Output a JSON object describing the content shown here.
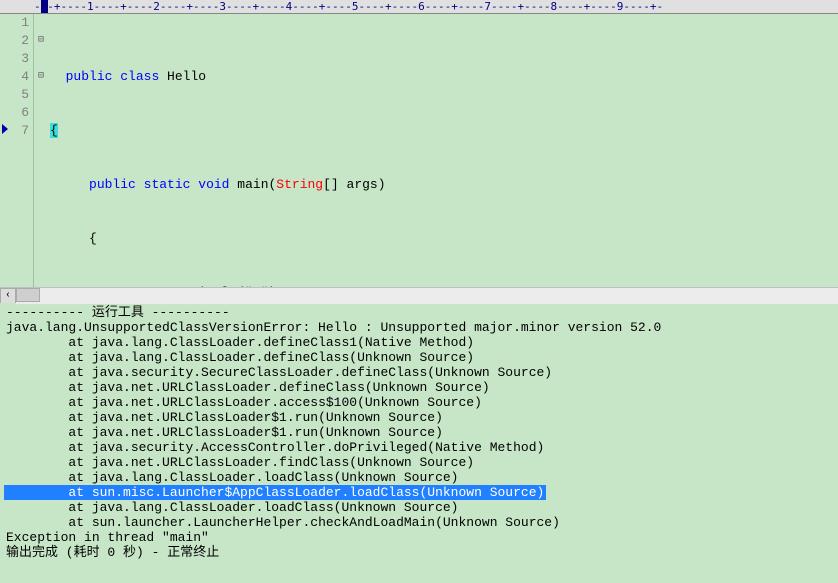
{
  "ruler": {
    "text": "---+----1----+----2----+----3----+----4----+----5----+----6----+----7----+----8----+----9----+-"
  },
  "editor": {
    "line_numbers": [
      "1",
      "2",
      "3",
      "4",
      "5",
      "6",
      "7"
    ],
    "fold_markers": [
      "",
      "⊟",
      "",
      "⊟",
      "",
      "",
      ""
    ],
    "code": {
      "l1": {
        "indent": "  ",
        "k1": "public",
        "s1": " ",
        "k2": "class",
        "rest": " Hello"
      },
      "l2": {
        "brace": "{"
      },
      "l3": {
        "indent": "     ",
        "k1": "public",
        "s1": " ",
        "k2": "static",
        "s2": " ",
        "k3": "void",
        "s3": " main(",
        "t": "String",
        "rest": "[] args)"
      },
      "l4": {
        "indent": "     ",
        "brace": "{"
      },
      "l5": {
        "indent": "      ",
        "t": "System",
        "s1": ".out.println(",
        "str": "\"c\"",
        "s2": ") ;"
      },
      "l6": {
        "indent": "      ",
        "brace": "}"
      },
      "l7": {
        "indent": "  ",
        "brace": "}"
      }
    }
  },
  "console": {
    "lines": [
      "---------- 运行工具 ----------",
      "java.lang.UnsupportedClassVersionError: Hello : Unsupported major.minor version 52.0",
      "\tat java.lang.ClassLoader.defineClass1(Native Method)",
      "\tat java.lang.ClassLoader.defineClass(Unknown Source)",
      "\tat java.security.SecureClassLoader.defineClass(Unknown Source)",
      "\tat java.net.URLClassLoader.defineClass(Unknown Source)",
      "\tat java.net.URLClassLoader.access$100(Unknown Source)",
      "\tat java.net.URLClassLoader$1.run(Unknown Source)",
      "\tat java.net.URLClassLoader$1.run(Unknown Source)",
      "\tat java.security.AccessController.doPrivileged(Native Method)",
      "\tat java.net.URLClassLoader.findClass(Unknown Source)",
      "\tat java.lang.ClassLoader.loadClass(Unknown Source)",
      "\tat sun.misc.Launcher$AppClassLoader.loadClass(Unknown Source)",
      "\tat java.lang.ClassLoader.loadClass(Unknown Source)",
      "\tat sun.launcher.LauncherHelper.checkAndLoadMain(Unknown Source)",
      "Exception in thread \"main\" ",
      "输出完成 (耗时 0 秒) - 正常终止"
    ],
    "highlighted_index": 12
  }
}
